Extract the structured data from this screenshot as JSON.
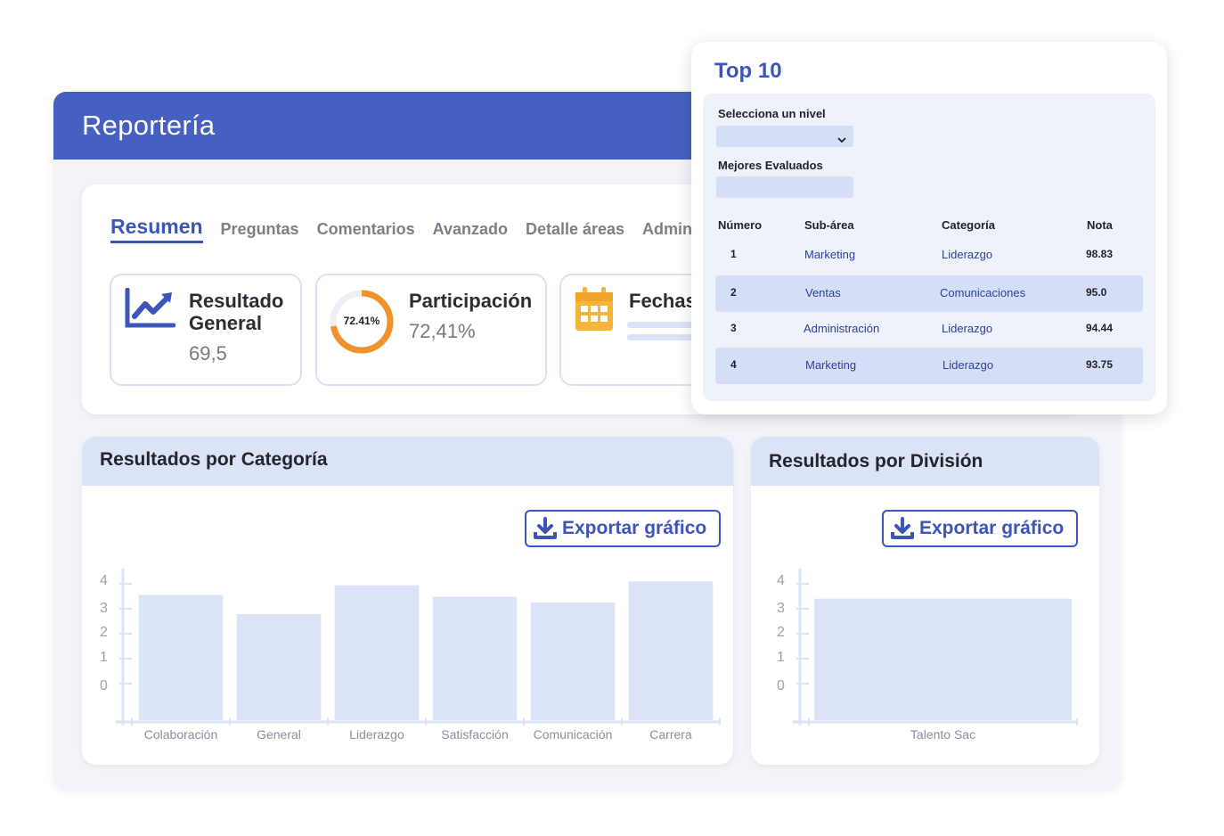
{
  "main": {
    "title": "Reportería"
  },
  "tabs": [
    "Resumen",
    "Preguntas",
    "Comentarios",
    "Avanzado",
    "Detalle áreas",
    "Adminis"
  ],
  "stats": {
    "resultado": {
      "line1": "Resultado",
      "line2": "General",
      "value": "69,5"
    },
    "participacion": {
      "title": "Participación",
      "value": "72,41%",
      "ring_label": "72.41%",
      "ring_fraction": 0.7241
    },
    "fechas": {
      "title": "Fechas"
    }
  },
  "categoria_panel": {
    "title": "Resultados por Categoría",
    "export_label": "Exportar gráfico"
  },
  "division_panel": {
    "title": "Resultados por División",
    "export_label": "Exportar gráfico"
  },
  "chart_data": [
    {
      "type": "bar",
      "categories": [
        "Colaboración",
        "General",
        "Liderazgo",
        "Satisfacción",
        "Comunicación",
        "Carrera"
      ],
      "values": [
        3.3,
        2.8,
        3.55,
        3.25,
        3.1,
        3.65
      ],
      "yticks": [
        0,
        1,
        2,
        3,
        4
      ],
      "ylim": [
        0,
        4
      ],
      "color": "#dbe3f7"
    },
    {
      "type": "bar",
      "categories": [
        "Talento Sac"
      ],
      "values": [
        3.2
      ],
      "yticks": [
        0,
        1,
        2,
        3,
        4
      ],
      "ylim": [
        0,
        4
      ],
      "color": "#dbe3f7"
    }
  ],
  "top10": {
    "title": "Top 10",
    "nivel_label": "Selecciona un nivel",
    "mejores_label": "Mejores Evaluados",
    "headers": {
      "numero": "Número",
      "subarea": "Sub-área",
      "categoria": "Categoría",
      "nota": "Nota"
    },
    "rows": [
      {
        "num": "1",
        "subarea": "Marketing",
        "categoria": "Liderazgo",
        "nota": "98.83"
      },
      {
        "num": "2",
        "subarea": "Ventas",
        "categoria": "Comunicaciones",
        "nota": "95.0"
      },
      {
        "num": "3",
        "subarea": "Administración",
        "categoria": "Liderazgo",
        "nota": "94.44"
      },
      {
        "num": "4",
        "subarea": "Marketing",
        "categoria": "Liderazgo",
        "nota": "93.75"
      }
    ]
  },
  "colors": {
    "brand": "#4560c1",
    "accent": "#3b55b8",
    "bar": "#dbe3f7",
    "ring": "#f0922b",
    "calendar": "#f5b43c"
  }
}
